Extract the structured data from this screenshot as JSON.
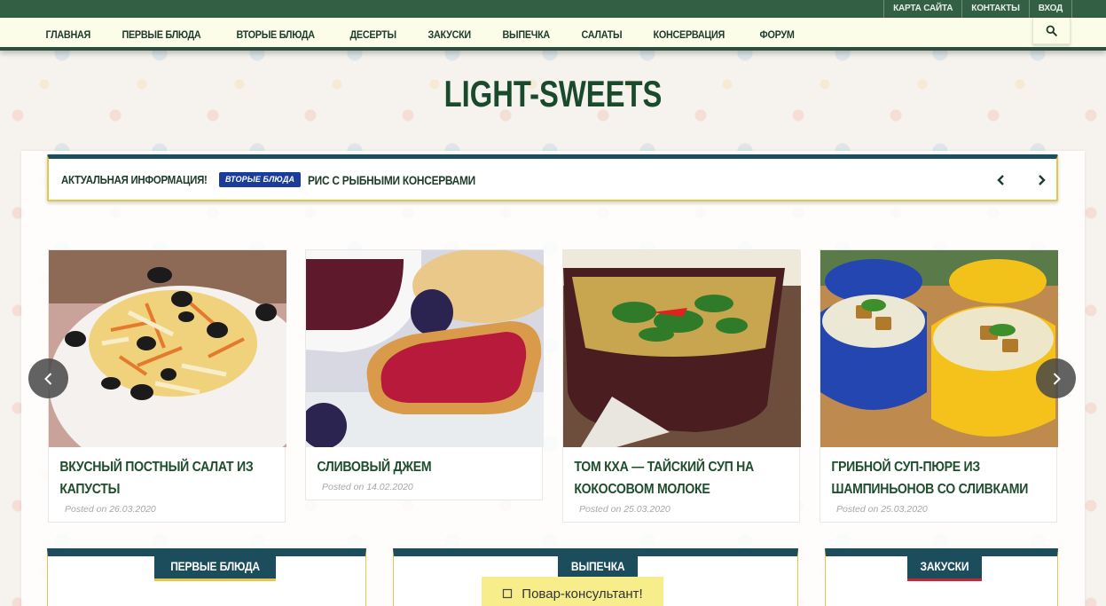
{
  "topbar": {
    "links": [
      "КАРТА САЙТА",
      "КОНТАКТЫ",
      "ВХОД"
    ]
  },
  "nav": {
    "items": [
      "ГЛАВНАЯ",
      "ПЕРВЫЕ БЛЮДА",
      "ВТОРЫЕ БЛЮДА",
      "ДЕСЕРТЫ",
      "ЗАКУСКИ",
      "ВЫПЕЧКА",
      "САЛАТЫ",
      "КОНСЕРВАЦИЯ",
      "ФОРУМ"
    ],
    "search_icon": "search-icon"
  },
  "site": {
    "title": "LIGHT-SWEETS"
  },
  "ticker": {
    "label": "АКТУАЛЬНАЯ ИНФОРМАЦИЯ!",
    "badge": "ВТОРЫЕ БЛЮДА",
    "headline": "РИС С РЫБНЫМИ КОНСЕРВАМИ",
    "prev_icon": "chevron-left-icon",
    "next_icon": "chevron-right-icon"
  },
  "cards": [
    {
      "title": "ВКУСНЫЙ ПОСТНЫЙ САЛАТ ИЗ КАПУСТЫ",
      "date": "Posted on 26.03.2020"
    },
    {
      "title": "СЛИВОВЫЙ ДЖЕМ",
      "date": "Posted on 14.02.2020"
    },
    {
      "title": "ТОМ КХА — ТАЙСКИЙ СУП НА КОКОСОВОМ МОЛОКЕ",
      "date": "Posted on 25.03.2020"
    },
    {
      "title": "ГРИБНОЙ СУП-ПЮРЕ ИЗ ШАМПИНЬОНОВ СО СЛИВКАМИ",
      "date": "Posted on 25.03.2020"
    }
  ],
  "widgets": [
    "ПЕРВЫЕ БЛЮДА",
    "ВЫПЕЧКА",
    "ЗАКУСКИ"
  ],
  "consult": {
    "label": "Повар-консультант!",
    "icon": "chat-icon"
  },
  "colors": {
    "topbar": "#335f45",
    "nav_bg": "#fbfde8",
    "accent_dark": "#1c4d5c",
    "gold": "#e5c647",
    "title_green": "#1a4a2c",
    "badge_blue": "#1a3c9a",
    "consult_yellow": "#f7ed8b"
  }
}
